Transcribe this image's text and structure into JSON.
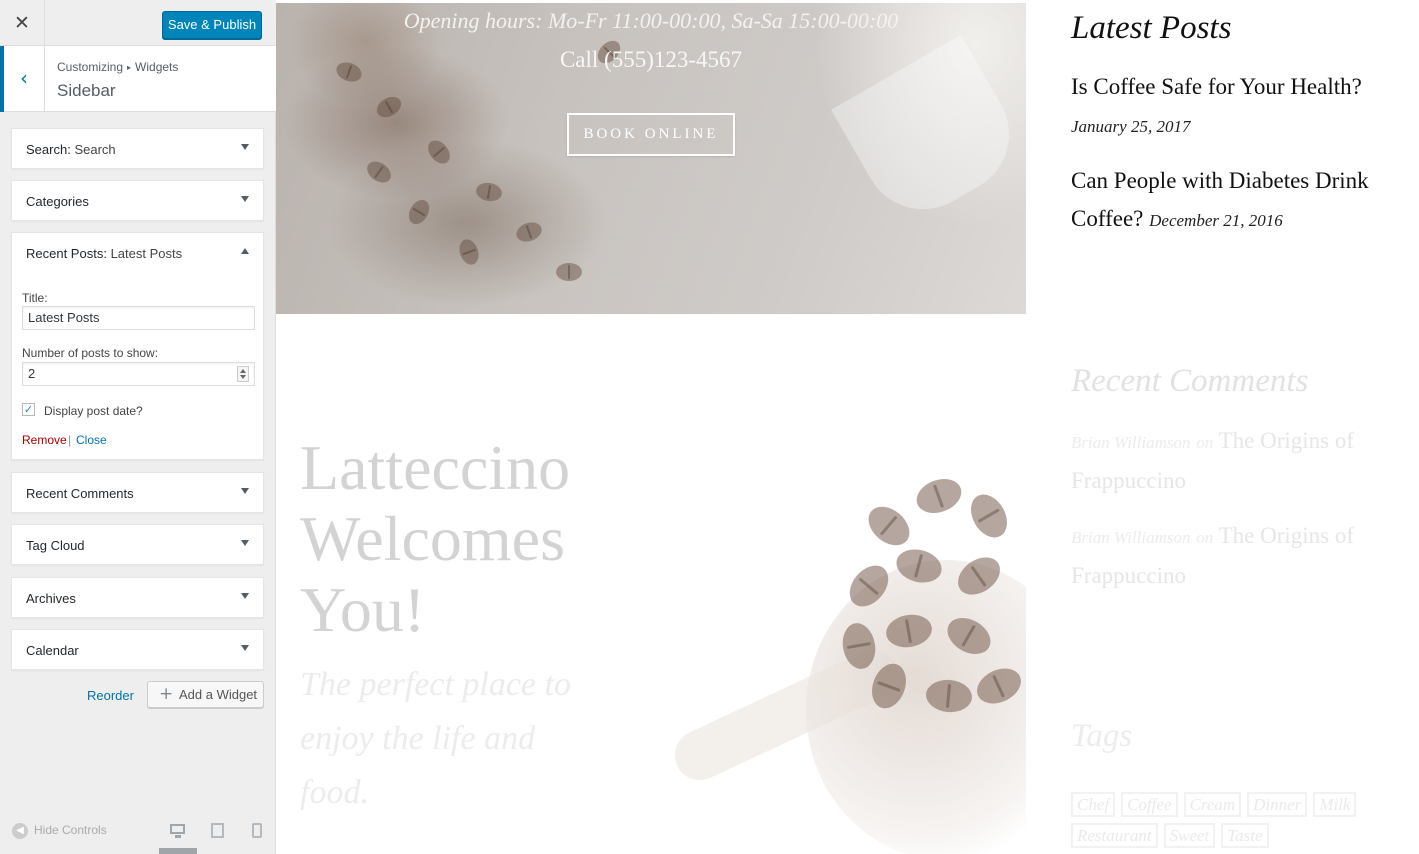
{
  "customizer": {
    "close_icon": "close-icon",
    "publish_label": "Save & Publish",
    "breadcrumb": {
      "root": "Customizing",
      "separator": "▸",
      "current": "Widgets"
    },
    "section_title": "Sidebar",
    "widgets": [
      {
        "type": "Search",
        "sep": ":",
        "title": " Search",
        "expanded": false
      },
      {
        "type": "Categories",
        "sep": "",
        "title": "",
        "expanded": false
      },
      {
        "type": "Recent Posts",
        "sep": ":",
        "title": " Latest Posts",
        "expanded": true
      },
      {
        "type": "Recent Comments",
        "sep": "",
        "title": "",
        "expanded": false
      },
      {
        "type": "Tag Cloud",
        "sep": "",
        "title": "",
        "expanded": false
      },
      {
        "type": "Archives",
        "sep": "",
        "title": "",
        "expanded": false
      },
      {
        "type": "Calendar",
        "sep": "",
        "title": "",
        "expanded": false
      }
    ],
    "form": {
      "title_label": "Title:",
      "title_value": "Latest Posts",
      "number_label": "Number of posts to show:",
      "number_value": "2",
      "display_date_label": "Display post date?",
      "display_date_checked": true,
      "remove_label": "Remove",
      "separator": "|",
      "close_label": "Close"
    },
    "reorder_label": "Reorder",
    "add_widget_label": "Add a Widget",
    "hide_controls_label": "Hide Controls",
    "devices": [
      "desktop-icon",
      "tablet-icon",
      "mobile-icon"
    ],
    "active_device": "desktop",
    "accent_color": "#0073aa",
    "publish_color": "#0085ba"
  },
  "preview": {
    "hours": "Opening hours: Mo-Fr 11:00-00:00, Sa-Sa 15:00-00:00",
    "phone": "Call (555)123-4567",
    "book_button": "BOOK ONLINE",
    "welcome_title": "Latteccino Welcomes You!",
    "welcome_subtitle": "The perfect place to enjoy the life and food.",
    "latest_posts": {
      "heading": "Latest Posts",
      "posts": [
        {
          "title": "Is Coffee Safe for Your Health?",
          "date": "January 25, 2017"
        },
        {
          "title": "Can People with Diabetes Drink Coffee?",
          "date": "December 21, 2016"
        }
      ]
    },
    "recent_comments": {
      "heading": "Recent Comments",
      "items": [
        {
          "author": "Brian Williamson",
          "on": "on",
          "post": "The Origins of Frappuccino"
        },
        {
          "author": "Brian Williamson",
          "on": "on",
          "post": "The Origins of Frappuccino"
        }
      ]
    },
    "tags": {
      "heading": "Tags",
      "items": [
        "Chef",
        "Coffee",
        "Cream",
        "Dinner",
        "Milk",
        "Restaurant",
        "Sweet",
        "Taste"
      ]
    }
  }
}
